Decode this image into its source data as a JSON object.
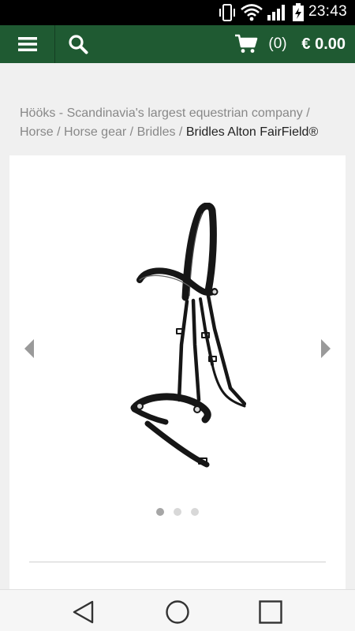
{
  "status_bar": {
    "time": "23:43",
    "icons": [
      "vibrate-icon",
      "wifi-icon",
      "signal-icon",
      "battery-charging-icon"
    ]
  },
  "header": {
    "menu_icon": "hamburger-menu-icon",
    "search_icon": "search-icon",
    "cart_icon": "shopping-cart-icon",
    "cart_count": "(0)",
    "cart_total": "€ 0.00",
    "background_color": "#1f5a32"
  },
  "breadcrumb": {
    "items": [
      "Hööks - Scandinavia's largest equestrian company",
      "Horse",
      "Horse gear",
      "Bridles"
    ],
    "separator": "/",
    "current": "Bridles Alton FairField®"
  },
  "gallery": {
    "product_image": "bridle-image",
    "prev_icon": "chevron-left-icon",
    "next_icon": "chevron-right-icon",
    "total_slides": 3,
    "active_slide": 1
  },
  "nav_bar": {
    "icons": [
      "back-icon",
      "home-icon",
      "recents-icon"
    ]
  }
}
